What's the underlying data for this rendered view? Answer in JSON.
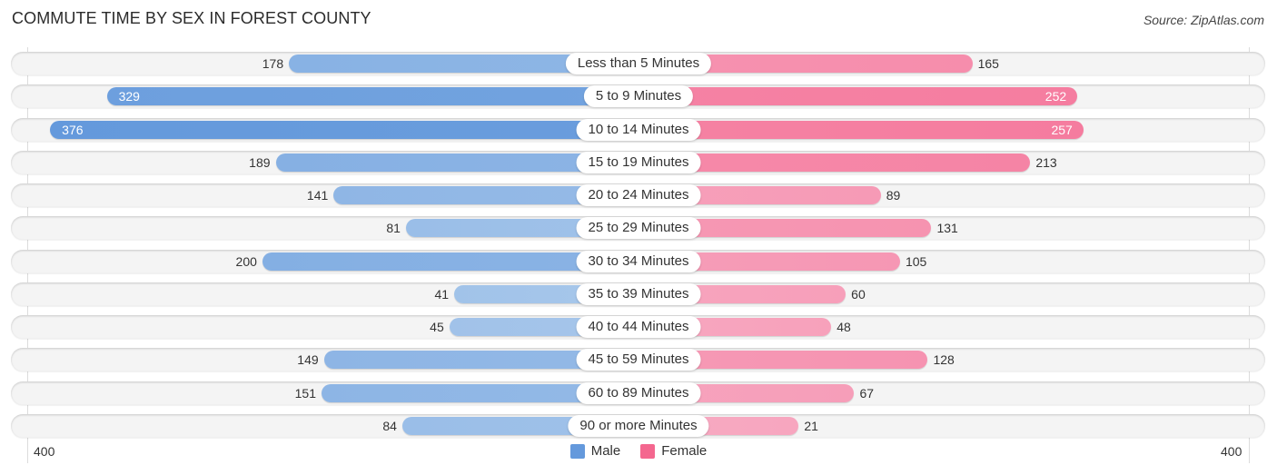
{
  "header": {
    "title": "COMMUTE TIME BY SEX IN FOREST COUNTY",
    "source": "Source: ZipAtlas.com"
  },
  "colors": {
    "male_strong": "#6499dc",
    "male_light": "#a9c8eb",
    "female_strong": "#f4678f",
    "female_light": "#f7aac2"
  },
  "chart_data": {
    "type": "bar",
    "orientation": "horizontal-diverging",
    "title": "COMMUTE TIME BY SEX IN FOREST COUNTY",
    "categories": [
      "Less than 5 Minutes",
      "5 to 9 Minutes",
      "10 to 14 Minutes",
      "15 to 19 Minutes",
      "20 to 24 Minutes",
      "25 to 29 Minutes",
      "30 to 34 Minutes",
      "35 to 39 Minutes",
      "40 to 44 Minutes",
      "45 to 59 Minutes",
      "60 to 89 Minutes",
      "90 or more Minutes"
    ],
    "series": [
      {
        "name": "Male",
        "side": "left",
        "values": [
          178,
          329,
          376,
          189,
          141,
          81,
          200,
          41,
          45,
          149,
          151,
          84
        ]
      },
      {
        "name": "Female",
        "side": "right",
        "values": [
          165,
          252,
          257,
          213,
          89,
          131,
          105,
          60,
          48,
          128,
          67,
          21
        ]
      }
    ],
    "axis": {
      "left_label": "400",
      "right_label": "400",
      "max": 400
    },
    "legend": {
      "position": "bottom-center",
      "entries": [
        "Male",
        "Female"
      ]
    },
    "xlabel": "",
    "ylabel": ""
  }
}
